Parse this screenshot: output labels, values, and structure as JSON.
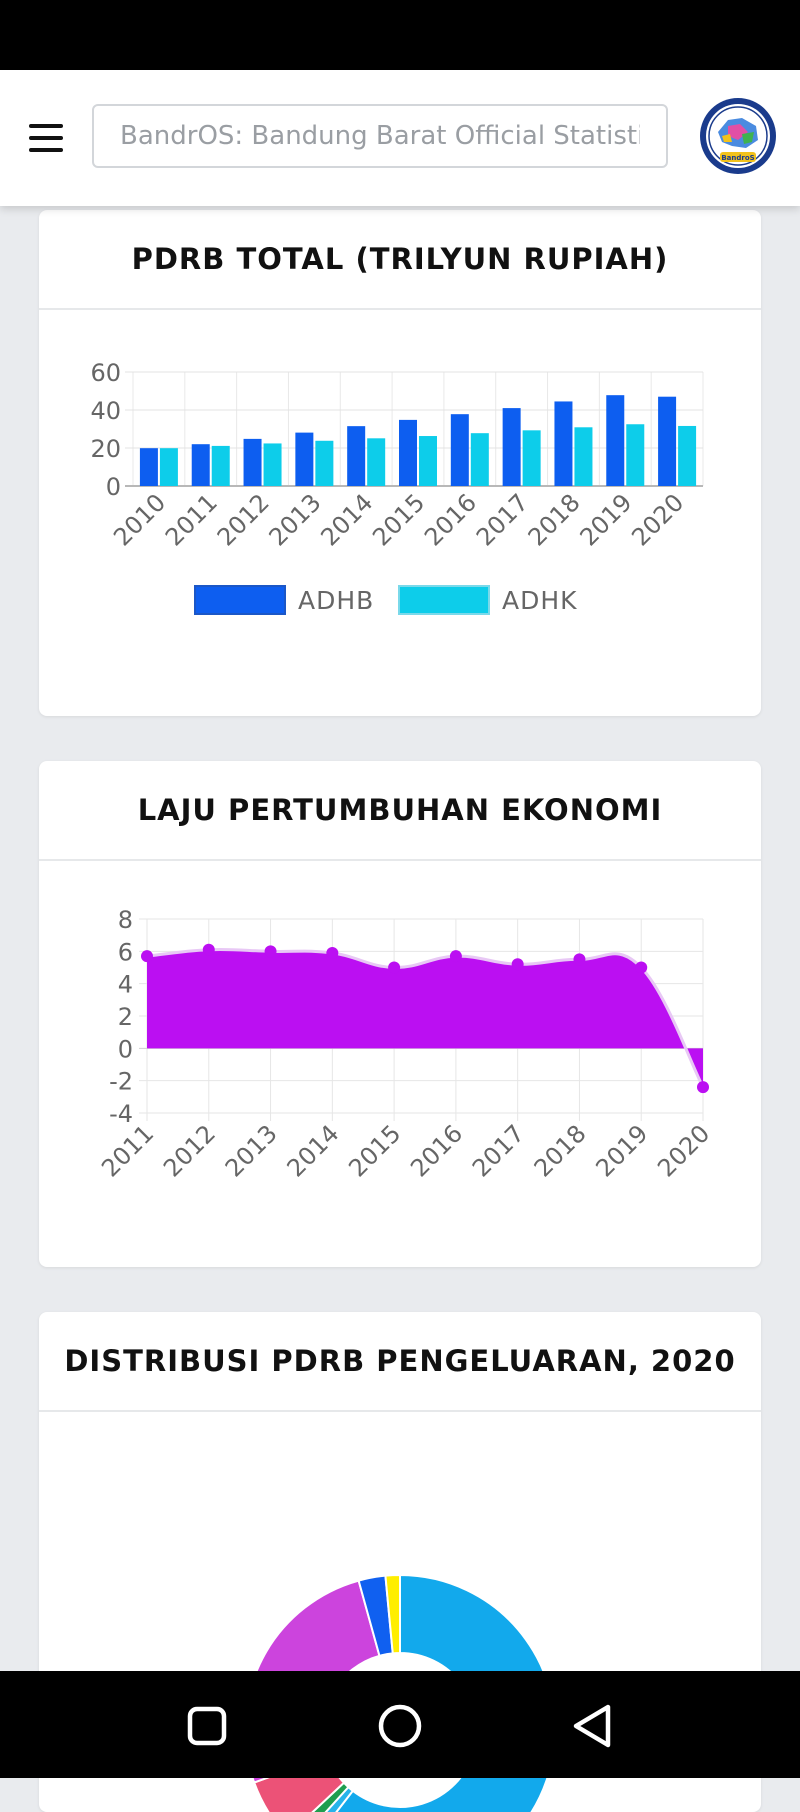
{
  "header": {
    "search_placeholder": "BandrOS: Bandung Barat Official Statistics",
    "logo_text": "BandroS"
  },
  "cards": {
    "pdrb_total": {
      "title": "PDRB TOTAL (TRILYUN RUPIAH)"
    },
    "laju": {
      "title": "LAJU PERTUMBUHAN EKONOMI"
    },
    "distribusi": {
      "title": "DISTRIBUSI PDRB PENGELUARAN, 2020"
    }
  },
  "colors": {
    "adhb": "#0d5ef0",
    "adhk": "#0dcdea",
    "growth": "#bb0ff2",
    "accent_blue": "#12a9ec"
  },
  "chart_data": [
    {
      "type": "bar",
      "categories": [
        "2010",
        "2011",
        "2012",
        "2013",
        "2014",
        "2015",
        "2016",
        "2017",
        "2018",
        "2019",
        "2020"
      ],
      "series": [
        {
          "name": "ADHB",
          "values": [
            19.9,
            22.0,
            24.8,
            28.1,
            31.5,
            34.8,
            37.8,
            41.0,
            44.5,
            47.8,
            47.0
          ],
          "color": "#0d5ef0"
        },
        {
          "name": "ADHK",
          "values": [
            19.9,
            21.1,
            22.4,
            23.8,
            25.1,
            26.3,
            27.8,
            29.3,
            30.9,
            32.5,
            31.6
          ],
          "color": "#0dcdea"
        }
      ],
      "ylim": [
        0,
        60
      ],
      "yticks": [
        0,
        20,
        40,
        60
      ],
      "grid": true,
      "legend": "bottom"
    },
    {
      "type": "area",
      "x": [
        "2011",
        "2012",
        "2013",
        "2014",
        "2015",
        "2016",
        "2017",
        "2018",
        "2019",
        "2020"
      ],
      "values": [
        5.7,
        6.1,
        6.0,
        5.9,
        5.0,
        5.7,
        5.2,
        5.5,
        5.0,
        -2.4
      ],
      "color": "#bb0ff2",
      "ylim": [
        -4,
        8
      ],
      "yticks": [
        8,
        6,
        4,
        2,
        0,
        -2,
        -4
      ],
      "grid": true
    },
    {
      "type": "pie",
      "title": "DISTRIBUSI PDRB PENGELUARAN, 2020",
      "labels": [],
      "values": [
        60.5,
        1.2,
        1.3,
        6.5,
        26.2,
        2.8,
        1.5
      ],
      "colors": [
        "#12a9ec",
        "#26b3ea",
        "#1f9e4f",
        "#ec5277",
        "#cc44dd",
        "#1060f0",
        "#ffee00"
      ],
      "donut": true
    }
  ]
}
